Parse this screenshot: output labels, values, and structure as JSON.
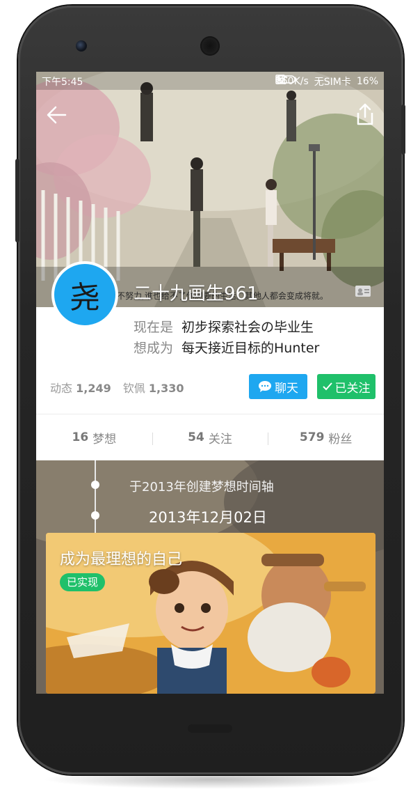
{
  "status_bar": {
    "time": "下午5:45",
    "speed": "560K/s",
    "sim": "无SIM卡",
    "battery": "16%"
  },
  "header": {
    "back_icon": "arrow-left-icon",
    "share_icon": "share-icon"
  },
  "cover": {
    "caption": "你不努力,谁也给不了你想要的生活。其他人都会变成将就。"
  },
  "profile": {
    "avatar_text": "尧",
    "name": "二十九画生961",
    "current_label": "现在是",
    "current_value": "初步探索社会の毕业生",
    "future_label": "想成为",
    "future_value": "每天接近目标的Hunter",
    "stats": {
      "posts_label": "动态",
      "posts_value": "1,249",
      "admire_label": "钦佩",
      "admire_value": "1,330"
    },
    "chat_button": "聊天",
    "follow_button": "已关注"
  },
  "tabs": [
    {
      "count": "16",
      "label": "梦想"
    },
    {
      "count": "54",
      "label": "关注"
    },
    {
      "count": "579",
      "label": "粉丝"
    }
  ],
  "timeline": {
    "created_text": "于2013年创建梦想时间轴",
    "date": "2013年12月02日",
    "card": {
      "title": "成为最理想的自己",
      "badge": "已实现"
    }
  },
  "colors": {
    "accent_blue": "#1ea7f0",
    "accent_green": "#1fc06a"
  }
}
